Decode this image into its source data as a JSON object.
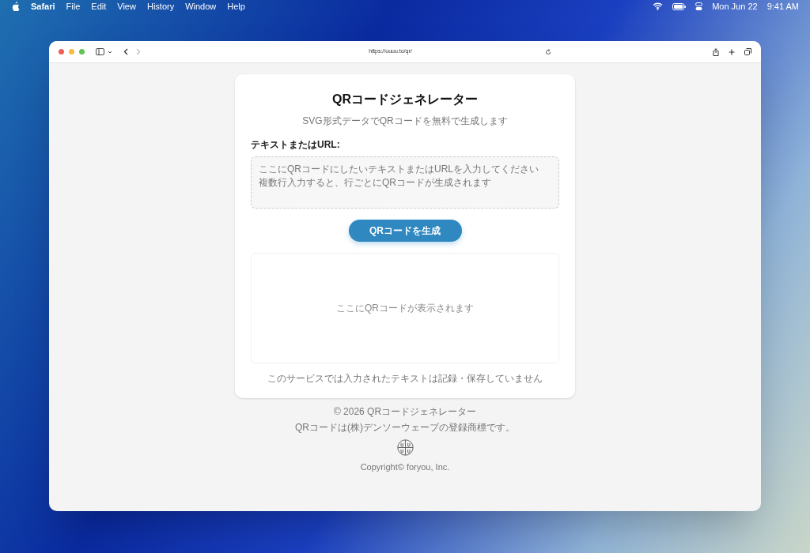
{
  "menu_bar": {
    "app": "Safari",
    "menus": [
      "File",
      "Edit",
      "View",
      "History",
      "Window",
      "Help"
    ],
    "date": "Mon Jun 22",
    "time": "9:41 AM"
  },
  "browser": {
    "url": "https://uuuu.to/qr/"
  },
  "card": {
    "title": "QRコードジェネレーター",
    "subtitle": "SVG形式データでQRコードを無料で生成します",
    "field_label": "テキストまたはURL:",
    "placeholder": [
      "ここにQRコードにしたいテキストまたはURLを入力してください",
      "複数行入力すると、行ごとにQRコードが生成されます"
    ],
    "button": "QRコードを生成",
    "preview_text": "ここにQRコードが表示されます",
    "note": "このサービスでは入力されたテキストは記録・保存していません"
  },
  "footer": {
    "lines": [
      "© 2026 QRコードジェネレーター",
      "QRコードは(株)デンソーウェーブの登録商標です。"
    ],
    "copyright": "Copyright© foryou, Inc."
  }
}
